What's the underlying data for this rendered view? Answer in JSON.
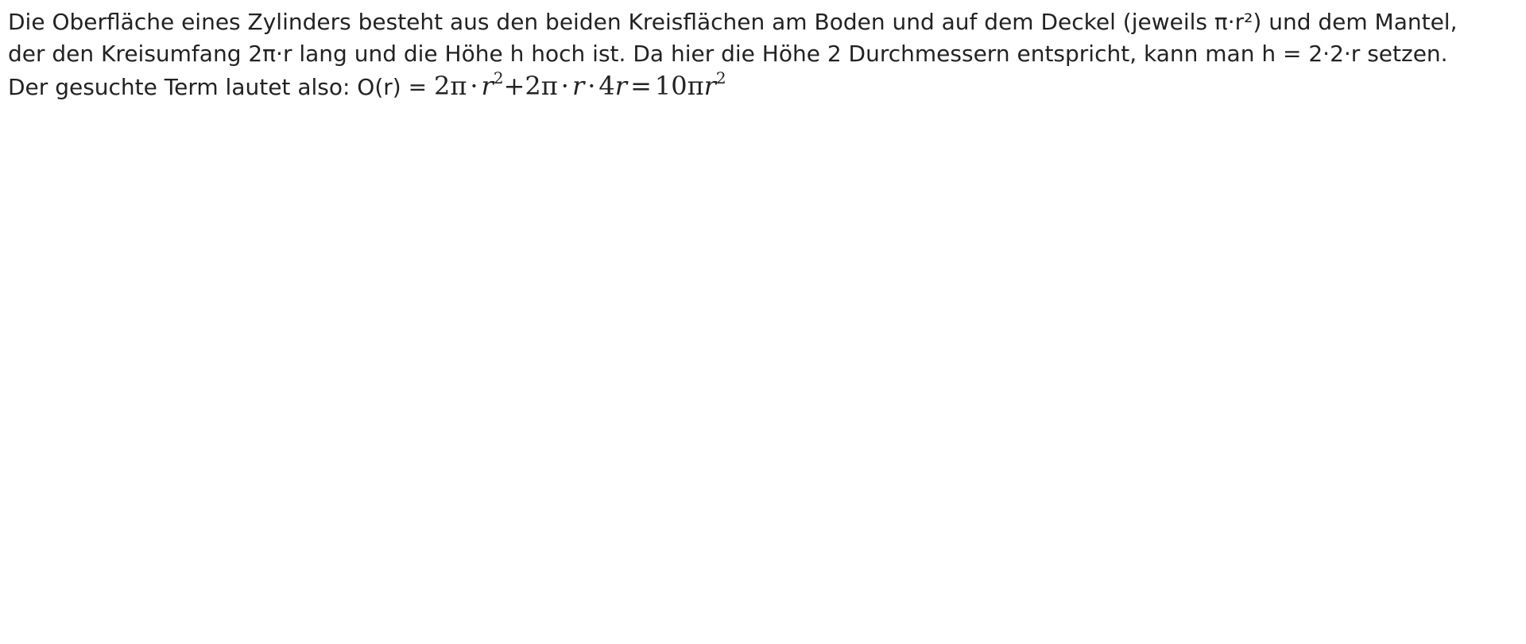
{
  "text": {
    "line1": "Die Oberfläche eines Zylinders besteht aus den beiden Kreisflächen am Boden und auf dem Deckel (jeweils π·r²) und dem Mantel,",
    "line2": "der den Kreisumfang 2π·r lang und die Höhe h hoch ist. Da hier die Höhe 2 Durchmessern entspricht, kann man h = 2·2·r setzen.",
    "line3_prefix": "Der gesuchte Term lautet also: O(r) = "
  },
  "formula": {
    "t1_coef": "2π",
    "t1_dot": "·",
    "t1_var": "r",
    "t1_exp": "2",
    "plus": "+",
    "t2_coef": "2π",
    "t2_dot1": "·",
    "t2_var": "r",
    "t2_dot2": "·",
    "t2_num": "4",
    "t2_var2": "r",
    "eq": "=",
    "res_coef": "10π",
    "res_var": "r",
    "res_exp": "2"
  }
}
